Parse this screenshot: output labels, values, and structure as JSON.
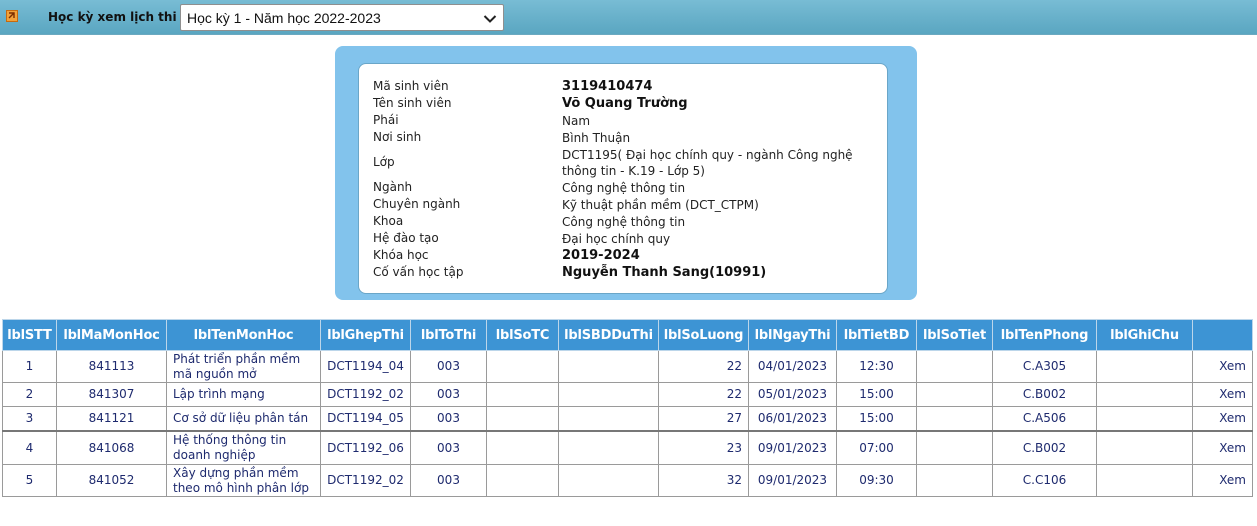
{
  "header": {
    "semester_label": "Học kỳ xem lịch thi",
    "semester_selected": "Học kỳ 1 - Năm học 2022-2023"
  },
  "student": {
    "rows": [
      {
        "label": "Mã sinh viên",
        "value": "3119410474"
      },
      {
        "label": "Tên sinh viên",
        "value": "Võ Quang Trường"
      },
      {
        "label": "Phái",
        "value": "Nam"
      },
      {
        "label": "Nơi sinh",
        "value": "Bình Thuận"
      },
      {
        "label": "Lớp",
        "value": "DCT1195( Đại học chính quy - ngành Công nghệ thông tin - K.19 - Lớp 5)"
      },
      {
        "label": "Ngành",
        "value": "Công nghệ thông tin"
      },
      {
        "label": "Chuyên ngành",
        "value": "Kỹ thuật phần mềm (DCT_CTPM)"
      },
      {
        "label": "Khoa",
        "value": "Công nghệ thông tin"
      },
      {
        "label": "Hệ đào tạo",
        "value": "Đại học chính quy"
      },
      {
        "label": "Khóa học",
        "value": "2019-2024"
      },
      {
        "label": "Cố vấn học tập",
        "value": "Nguyễn Thanh Sang(10991)"
      }
    ]
  },
  "table": {
    "headers": [
      "lblSTT",
      "lblMaMonHoc",
      "lblTenMonHoc",
      "lblGhepThi",
      "lblToThi",
      "lblSoTC",
      "lblSBDDuThi",
      "lblSoLuong",
      "lblNgayThi",
      "lblTietBD",
      "lblSoTiet",
      "lblTenPhong",
      "lblGhiChu",
      ""
    ],
    "rows": [
      [
        "1",
        "841113",
        "Phát triển phần mềm mã nguồn mở",
        "DCT1194_04",
        "003",
        "",
        "",
        "22",
        "04/01/2023",
        "12:30",
        "",
        "C.A305",
        "",
        "Xem"
      ],
      [
        "2",
        "841307",
        "Lập trình mạng",
        "DCT1192_02",
        "003",
        "",
        "",
        "22",
        "05/01/2023",
        "15:00",
        "",
        "C.B002",
        "",
        "Xem"
      ],
      [
        "3",
        "841121",
        "Cơ sở dữ liệu phân tán",
        "DCT1194_05",
        "003",
        "",
        "",
        "27",
        "06/01/2023",
        "15:00",
        "",
        "C.A506",
        "",
        "Xem"
      ],
      [
        "4",
        "841068",
        "Hệ thống thông tin doanh nghiệp",
        "DCT1192_06",
        "003",
        "",
        "",
        "23",
        "09/01/2023",
        "07:00",
        "",
        "C.B002",
        "",
        "Xem"
      ],
      [
        "5",
        "841052",
        "Xây dựng phần mềm theo mô hình phân lớp",
        "DCT1192_02",
        "003",
        "",
        "",
        "32",
        "09/01/2023",
        "09:30",
        "",
        "C.C106",
        "",
        "Xem"
      ]
    ]
  }
}
